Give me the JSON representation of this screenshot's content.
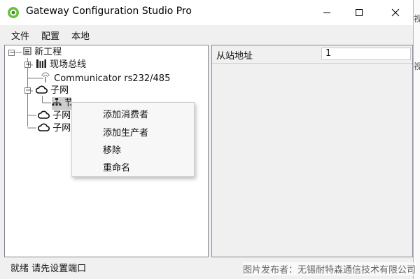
{
  "window": {
    "title": "Gateway Configuration Studio Pro",
    "controls": [
      "minimize",
      "maximize",
      "close"
    ]
  },
  "menu": [
    "文件",
    "配置",
    "本地"
  ],
  "tree": {
    "root": "新工程",
    "fieldbus": "现场总线",
    "communicator": "Communicator rs232/485",
    "subnet1": "子网",
    "node_partial": "节点",
    "subnet2": "子网",
    "subnet3": "子网",
    "expander_plus": "+",
    "expander_minus": "−"
  },
  "properties": {
    "label": "从站地址",
    "value": "1"
  },
  "context_menu": [
    "添加消费者",
    "添加生产者",
    "移除",
    "重命名"
  ],
  "status": {
    "ready": "就绪",
    "message": "请先设置端口"
  },
  "watermark": "图片发布者：无锡耐特森通信技术有限公司",
  "edge_text": [
    "视",
    "视"
  ]
}
